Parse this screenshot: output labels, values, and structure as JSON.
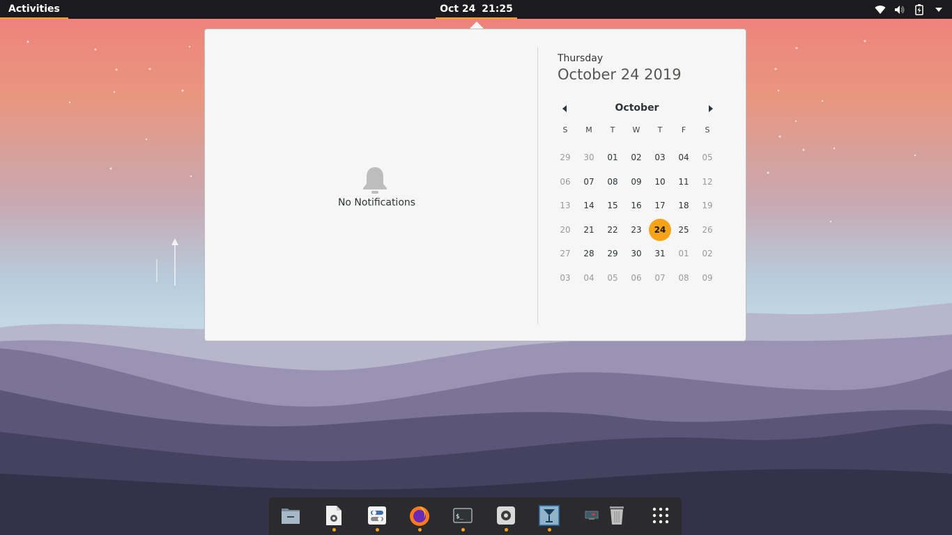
{
  "topbar": {
    "activities_label": "Activities",
    "clock_date": "Oct 24",
    "clock_time": "21:25",
    "tray_icons": [
      "wifi-icon",
      "volume-icon",
      "battery-icon",
      "system-menu-arrow-icon"
    ]
  },
  "notifications": {
    "icon": "bell-icon",
    "message": "No Notifications"
  },
  "calendar": {
    "weekday": "Thursday",
    "full_date": "October 24 2019",
    "month": "October",
    "weekday_headers": [
      "S",
      "M",
      "T",
      "W",
      "T",
      "F",
      "S"
    ],
    "weeks": [
      [
        "29",
        "30",
        "01",
        "02",
        "03",
        "04",
        "05"
      ],
      [
        "06",
        "07",
        "08",
        "09",
        "10",
        "11",
        "12"
      ],
      [
        "13",
        "14",
        "15",
        "16",
        "17",
        "18",
        "19"
      ],
      [
        "20",
        "21",
        "22",
        "23",
        "24",
        "25",
        "26"
      ],
      [
        "27",
        "28",
        "29",
        "30",
        "31",
        "01",
        "02"
      ],
      [
        "03",
        "04",
        "05",
        "06",
        "07",
        "08",
        "09"
      ]
    ],
    "selected_day": "24",
    "accent_color": "#f6a31a"
  },
  "dock": {
    "apps": [
      {
        "name": "files",
        "icon": "files-icon",
        "running": false
      },
      {
        "name": "text-editor-settings",
        "icon": "document-gear-icon",
        "running": true
      },
      {
        "name": "tweaks",
        "icon": "tweaks-icon",
        "running": true
      },
      {
        "name": "firefox",
        "icon": "firefox-icon",
        "running": true
      },
      {
        "name": "terminal",
        "icon": "terminal-icon",
        "running": true
      },
      {
        "name": "settings",
        "icon": "settings-gear-icon",
        "running": true
      },
      {
        "name": "cocktail",
        "icon": "cocktail-icon",
        "running": true
      },
      {
        "name": "screen",
        "icon": "monitor-icon",
        "running": false
      },
      {
        "name": "trash",
        "icon": "trash-icon",
        "running": false
      },
      {
        "name": "show-apps",
        "icon": "app-grid-icon",
        "running": false
      }
    ]
  }
}
